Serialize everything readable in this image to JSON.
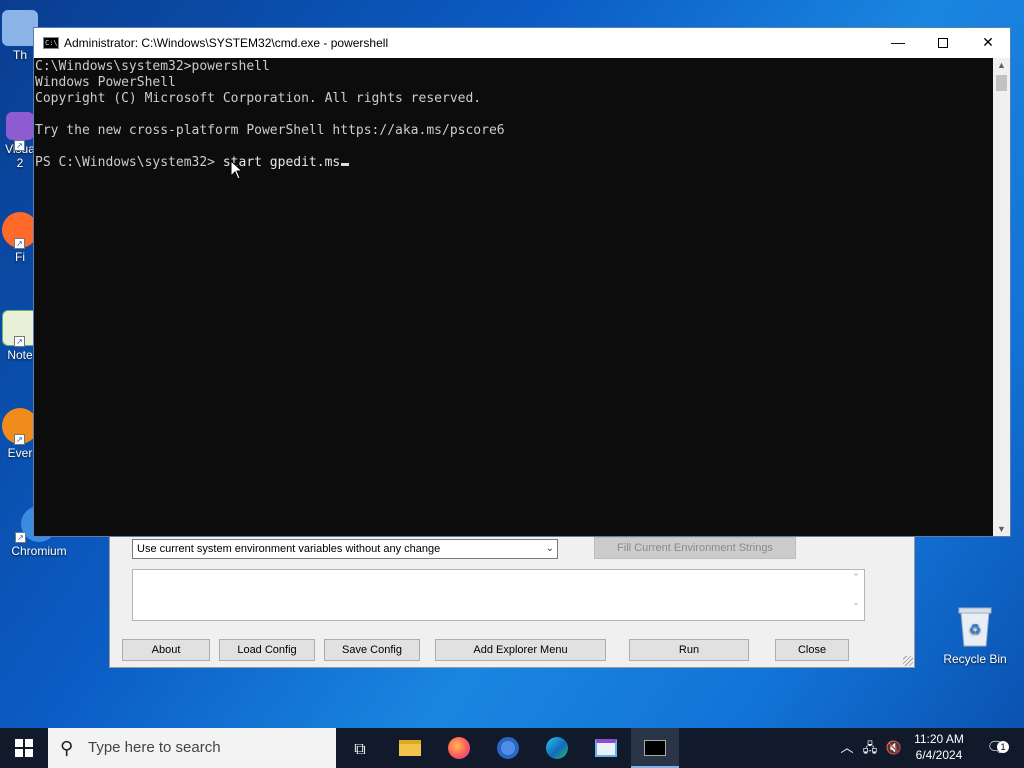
{
  "desktop": {
    "icons_left": [
      {
        "label": "Th",
        "color": "#8ab4e8"
      },
      {
        "label": "Visua\n2",
        "color": "#8e5bd0"
      },
      {
        "label": "Fi",
        "color": "#ff6a2b"
      },
      {
        "label": "Note",
        "color": "#6bb36b"
      },
      {
        "label": "Ever",
        "color": "#f08c1a"
      },
      {
        "label": "Chromium",
        "color": "#3b8be0"
      }
    ],
    "recycle_bin": {
      "label": "Recycle Bin"
    }
  },
  "cfg_window": {
    "env_select_value": "Use current system environment variables without any change",
    "fill_env_button": "Fill Current Environment Strings",
    "buttons": {
      "about": "About",
      "load_config": "Load Config",
      "save_config": "Save Config",
      "add_explorer_menu": "Add Explorer Menu",
      "run": "Run",
      "close": "Close"
    }
  },
  "console": {
    "title": "Administrator: C:\\Windows\\SYSTEM32\\cmd.exe - powershell",
    "app_icon_text": "C:\\_",
    "lines": [
      "C:\\Windows\\system32>powershell",
      "Windows PowerShell",
      "Copyright (C) Microsoft Corporation. All rights reserved.",
      "",
      "Try the new cross-platform PowerShell https://aka.ms/pscore6",
      ""
    ],
    "prompt": "PS C:\\Windows\\system32> ",
    "typed": "start gpedit.ms"
  },
  "taskbar": {
    "search_placeholder": "Type here to search",
    "time": "11:20 AM",
    "date": "6/4/2024",
    "notification_count": "1",
    "pinned": [
      "task-view",
      "file-explorer",
      "firefox",
      "chromium",
      "edge",
      "text-editor",
      "console"
    ]
  },
  "colors": {
    "console_bg": "#0c0c0c",
    "console_text": "#cccccc",
    "taskbar_bg": "#101a2b",
    "accent": "#0078d7"
  }
}
